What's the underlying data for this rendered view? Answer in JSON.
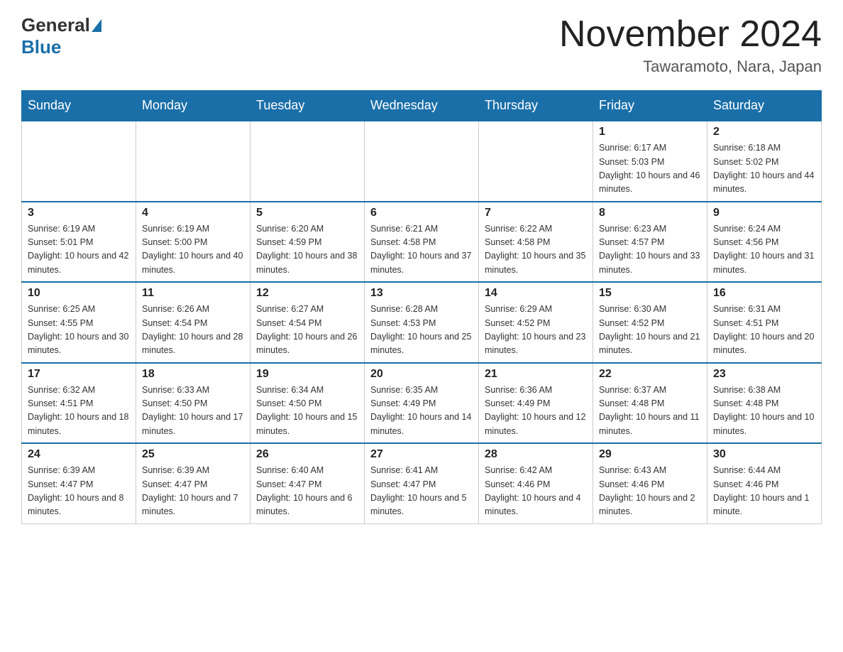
{
  "header": {
    "logo_general": "General",
    "logo_blue": "Blue",
    "month_title": "November 2024",
    "location": "Tawaramoto, Nara, Japan"
  },
  "days_of_week": [
    "Sunday",
    "Monday",
    "Tuesday",
    "Wednesday",
    "Thursday",
    "Friday",
    "Saturday"
  ],
  "weeks": [
    [
      {
        "day": "",
        "info": ""
      },
      {
        "day": "",
        "info": ""
      },
      {
        "day": "",
        "info": ""
      },
      {
        "day": "",
        "info": ""
      },
      {
        "day": "",
        "info": ""
      },
      {
        "day": "1",
        "info": "Sunrise: 6:17 AM\nSunset: 5:03 PM\nDaylight: 10 hours and 46 minutes."
      },
      {
        "day": "2",
        "info": "Sunrise: 6:18 AM\nSunset: 5:02 PM\nDaylight: 10 hours and 44 minutes."
      }
    ],
    [
      {
        "day": "3",
        "info": "Sunrise: 6:19 AM\nSunset: 5:01 PM\nDaylight: 10 hours and 42 minutes."
      },
      {
        "day": "4",
        "info": "Sunrise: 6:19 AM\nSunset: 5:00 PM\nDaylight: 10 hours and 40 minutes."
      },
      {
        "day": "5",
        "info": "Sunrise: 6:20 AM\nSunset: 4:59 PM\nDaylight: 10 hours and 38 minutes."
      },
      {
        "day": "6",
        "info": "Sunrise: 6:21 AM\nSunset: 4:58 PM\nDaylight: 10 hours and 37 minutes."
      },
      {
        "day": "7",
        "info": "Sunrise: 6:22 AM\nSunset: 4:58 PM\nDaylight: 10 hours and 35 minutes."
      },
      {
        "day": "8",
        "info": "Sunrise: 6:23 AM\nSunset: 4:57 PM\nDaylight: 10 hours and 33 minutes."
      },
      {
        "day": "9",
        "info": "Sunrise: 6:24 AM\nSunset: 4:56 PM\nDaylight: 10 hours and 31 minutes."
      }
    ],
    [
      {
        "day": "10",
        "info": "Sunrise: 6:25 AM\nSunset: 4:55 PM\nDaylight: 10 hours and 30 minutes."
      },
      {
        "day": "11",
        "info": "Sunrise: 6:26 AM\nSunset: 4:54 PM\nDaylight: 10 hours and 28 minutes."
      },
      {
        "day": "12",
        "info": "Sunrise: 6:27 AM\nSunset: 4:54 PM\nDaylight: 10 hours and 26 minutes."
      },
      {
        "day": "13",
        "info": "Sunrise: 6:28 AM\nSunset: 4:53 PM\nDaylight: 10 hours and 25 minutes."
      },
      {
        "day": "14",
        "info": "Sunrise: 6:29 AM\nSunset: 4:52 PM\nDaylight: 10 hours and 23 minutes."
      },
      {
        "day": "15",
        "info": "Sunrise: 6:30 AM\nSunset: 4:52 PM\nDaylight: 10 hours and 21 minutes."
      },
      {
        "day": "16",
        "info": "Sunrise: 6:31 AM\nSunset: 4:51 PM\nDaylight: 10 hours and 20 minutes."
      }
    ],
    [
      {
        "day": "17",
        "info": "Sunrise: 6:32 AM\nSunset: 4:51 PM\nDaylight: 10 hours and 18 minutes."
      },
      {
        "day": "18",
        "info": "Sunrise: 6:33 AM\nSunset: 4:50 PM\nDaylight: 10 hours and 17 minutes."
      },
      {
        "day": "19",
        "info": "Sunrise: 6:34 AM\nSunset: 4:50 PM\nDaylight: 10 hours and 15 minutes."
      },
      {
        "day": "20",
        "info": "Sunrise: 6:35 AM\nSunset: 4:49 PM\nDaylight: 10 hours and 14 minutes."
      },
      {
        "day": "21",
        "info": "Sunrise: 6:36 AM\nSunset: 4:49 PM\nDaylight: 10 hours and 12 minutes."
      },
      {
        "day": "22",
        "info": "Sunrise: 6:37 AM\nSunset: 4:48 PM\nDaylight: 10 hours and 11 minutes."
      },
      {
        "day": "23",
        "info": "Sunrise: 6:38 AM\nSunset: 4:48 PM\nDaylight: 10 hours and 10 minutes."
      }
    ],
    [
      {
        "day": "24",
        "info": "Sunrise: 6:39 AM\nSunset: 4:47 PM\nDaylight: 10 hours and 8 minutes."
      },
      {
        "day": "25",
        "info": "Sunrise: 6:39 AM\nSunset: 4:47 PM\nDaylight: 10 hours and 7 minutes."
      },
      {
        "day": "26",
        "info": "Sunrise: 6:40 AM\nSunset: 4:47 PM\nDaylight: 10 hours and 6 minutes."
      },
      {
        "day": "27",
        "info": "Sunrise: 6:41 AM\nSunset: 4:47 PM\nDaylight: 10 hours and 5 minutes."
      },
      {
        "day": "28",
        "info": "Sunrise: 6:42 AM\nSunset: 4:46 PM\nDaylight: 10 hours and 4 minutes."
      },
      {
        "day": "29",
        "info": "Sunrise: 6:43 AM\nSunset: 4:46 PM\nDaylight: 10 hours and 2 minutes."
      },
      {
        "day": "30",
        "info": "Sunrise: 6:44 AM\nSunset: 4:46 PM\nDaylight: 10 hours and 1 minute."
      }
    ]
  ]
}
